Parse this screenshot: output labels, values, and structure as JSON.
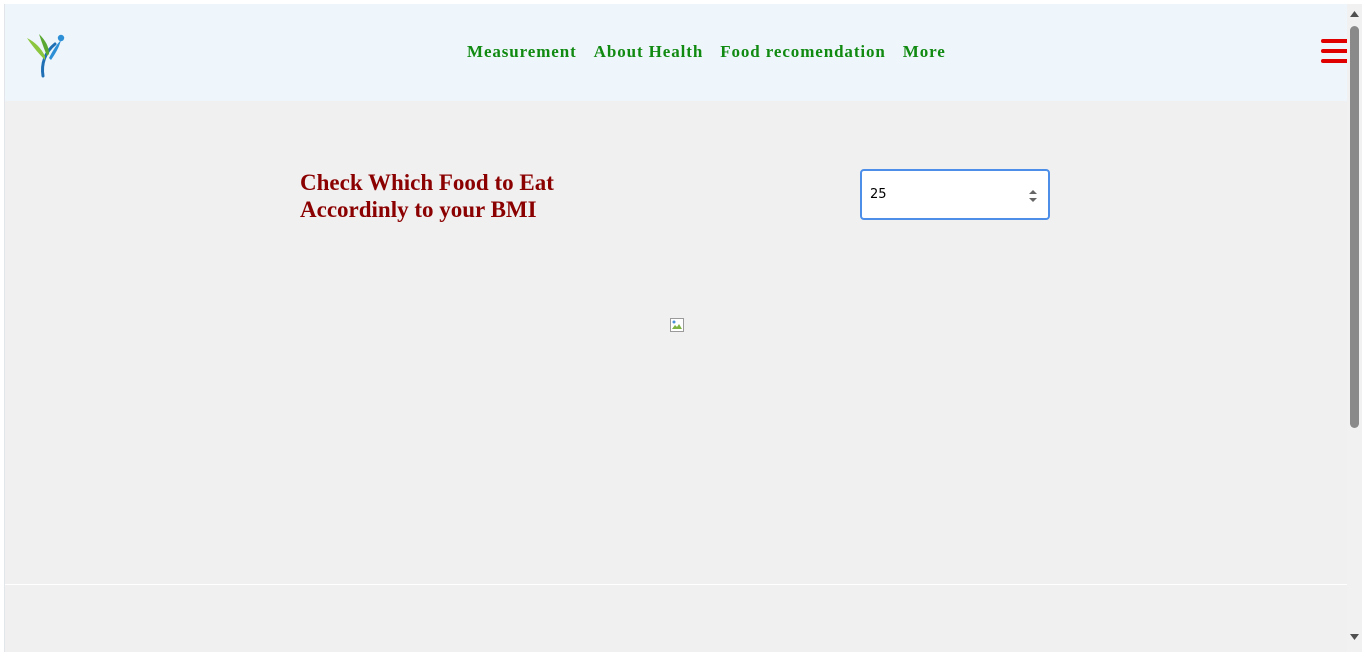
{
  "nav": {
    "logo_alt": "logo",
    "items": [
      {
        "label": "Measurement"
      },
      {
        "label": "About Health"
      },
      {
        "label": "Food recomendation"
      },
      {
        "label": "More"
      }
    ],
    "menu_icon": "hamburger-menu-icon"
  },
  "main": {
    "heading_line1": "Check Which Food to Eat",
    "heading_line2": "Accordinly to your BMI",
    "bmi_input": {
      "value": "25",
      "type": "number"
    },
    "image_icon": "broken-image-icon"
  },
  "colors": {
    "nav_link": "#118a11",
    "heading": "#8b0000",
    "hamburger": "#e00000",
    "navbar_bg": "#eef6fc",
    "page_bg": "#f0f0f0",
    "input_border": "#4d8ee8"
  }
}
